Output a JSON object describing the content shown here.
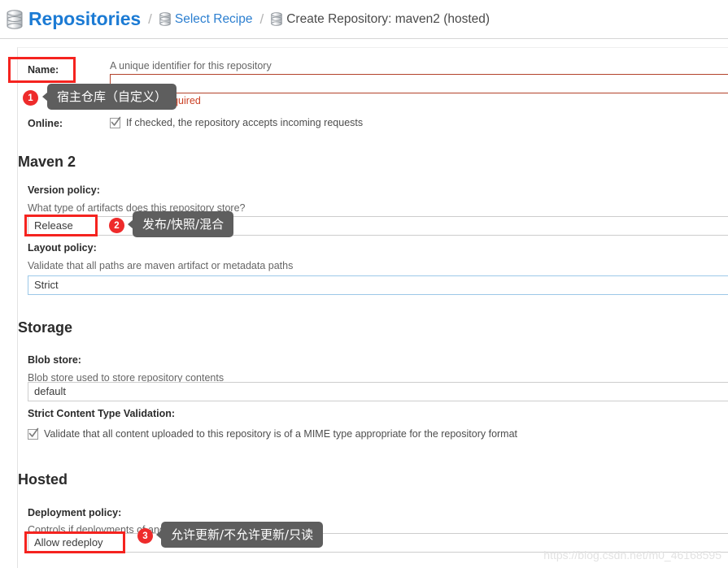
{
  "breadcrumb": {
    "root_label": "Repositories",
    "root_icon": "database-icon",
    "separator": "/",
    "link_label": "Select Recipe",
    "link_icon": "database-icon",
    "current_label": "Create Repository: maven2 (hosted)",
    "current_icon": "database-icon"
  },
  "form": {
    "name": {
      "label": "Name:",
      "helper": "A unique identifier for this repository",
      "value": "",
      "placeholder": "",
      "error": "This field is required"
    },
    "online": {
      "label": "Online:",
      "checkbox_label": "If checked, the repository accepts incoming requests",
      "checked": true
    },
    "maven2": {
      "section_title": "Maven 2",
      "version_policy": {
        "label": "Version policy:",
        "helper": "What type of artifacts does this repository store?",
        "value": "Release"
      },
      "layout_policy": {
        "label": "Layout policy:",
        "helper": "Validate that all paths are maven artifact or metadata paths",
        "value": "Strict"
      }
    },
    "storage": {
      "section_title": "Storage",
      "blob_store": {
        "label": "Blob store:",
        "helper": "Blob store used to store repository contents",
        "value": "default"
      },
      "strict_content_type": {
        "label": "Strict Content Type Validation:",
        "checkbox_label": "Validate that all content uploaded to this repository is of a MIME type appropriate for the repository format",
        "checked": true
      }
    },
    "hosted": {
      "section_title": "Hosted",
      "deployment_policy": {
        "label": "Deployment policy:",
        "helper": "Controls if deployments of and updates to artifacts are allowed",
        "value": "Allow redeploy"
      }
    }
  },
  "annotations": {
    "one": {
      "number": "1",
      "text": "宿主仓库（自定义）"
    },
    "two": {
      "number": "2",
      "text": "发布/快照/混合"
    },
    "three": {
      "number": "3",
      "text": "允许更新/不允许更新/只读"
    }
  },
  "watermark": "https://blog.csdn.net/m0_46168595",
  "colors": {
    "accent_blue": "#1c7bd4",
    "error_red": "#cc4125",
    "annotation_red": "#ee2b2b",
    "tooltip_gray": "#5e5e5e"
  }
}
